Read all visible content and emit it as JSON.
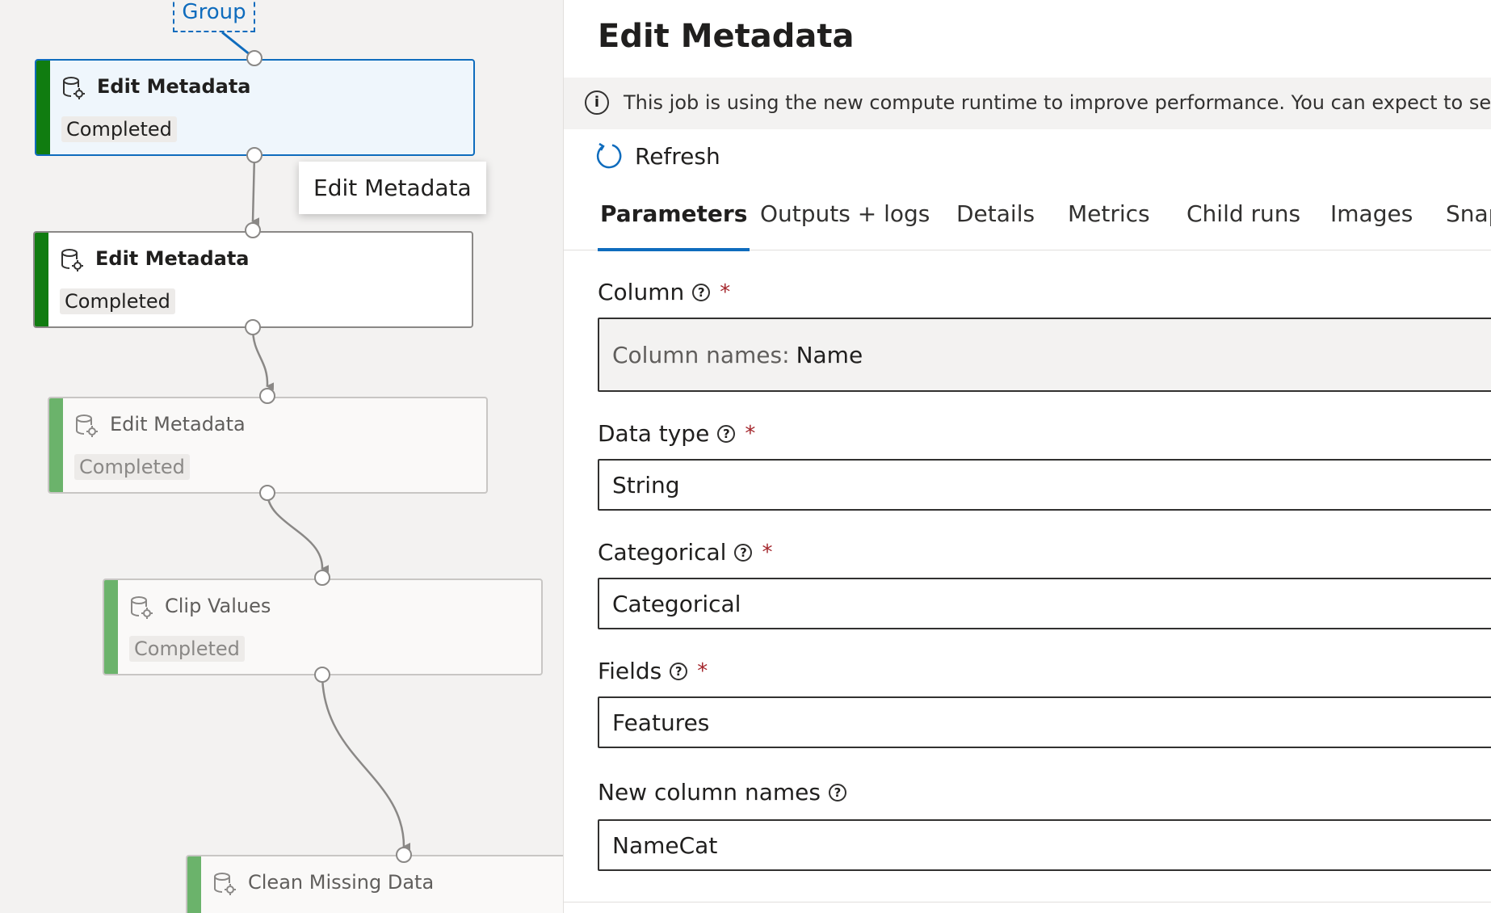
{
  "canvas": {
    "group_label": "Group",
    "nodes": [
      {
        "title": "Edit Metadata",
        "status": "Completed"
      },
      {
        "title": "Edit Metadata",
        "status": "Completed"
      },
      {
        "title": "Edit Metadata",
        "status": "Completed"
      },
      {
        "title": "Clip Values",
        "status": "Completed"
      },
      {
        "title": "Clean Missing Data",
        "status": ""
      }
    ],
    "tooltip": "Edit Metadata"
  },
  "panel": {
    "title": "Edit Metadata",
    "info_text": "This job is using the new compute runtime to improve performance. You can expect to see a different",
    "refresh_label": "Refresh",
    "tabs": [
      "Parameters",
      "Outputs + logs",
      "Details",
      "Metrics",
      "Child runs",
      "Images",
      "Snap"
    ],
    "active_tab": "Parameters",
    "fields": {
      "column": {
        "label": "Column",
        "prefix": "Column names:",
        "value": "Name"
      },
      "data_type": {
        "label": "Data type",
        "value": "String"
      },
      "categorical": {
        "label": "Categorical",
        "value": "Categorical"
      },
      "fields": {
        "label": "Fields",
        "value": "Features"
      },
      "new_column_names": {
        "label": "New column names",
        "value": "NameCat"
      }
    },
    "required_mark": "*",
    "help_glyph": "?",
    "info_glyph": "i"
  },
  "colors": {
    "accent": "#0f6cbd",
    "success": "#107c10",
    "required": "#a4262c"
  },
  "icons": [
    "dataset-gear-icon",
    "info-icon",
    "refresh-icon",
    "help-icon"
  ]
}
